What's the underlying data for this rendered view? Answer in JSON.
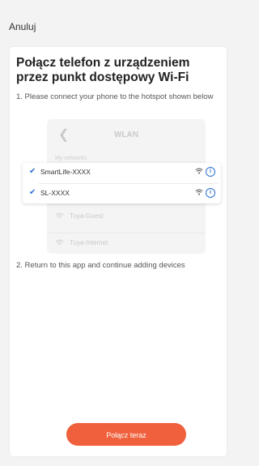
{
  "header": {
    "cancel_label": "Anuluj"
  },
  "main": {
    "title": "Połącz telefon z urządzeniem przez punkt dostępowy Wi-Fi",
    "step1_text": "1. Please connect your phone to the hotspot shown below",
    "step2_text": "2. Return to this app and continue adding devices",
    "connect_button_label": "Połącz teraz"
  },
  "illustration": {
    "back_icon": "chevron-left-icon",
    "wlan_title": "WLAN",
    "section_label": "My networks",
    "highlighted_networks": [
      {
        "name": "SmartLife-XXXX",
        "selected": true
      },
      {
        "name": "SL-XXXX",
        "selected": true
      }
    ],
    "other_networks": [
      {
        "name": "Tuya-Guest"
      },
      {
        "name": "Tuya-Internet"
      }
    ]
  },
  "colors": {
    "accent": "#f0603c",
    "check": "#2a70d6",
    "background": "#f3f3f3",
    "card": "#ffffff"
  }
}
